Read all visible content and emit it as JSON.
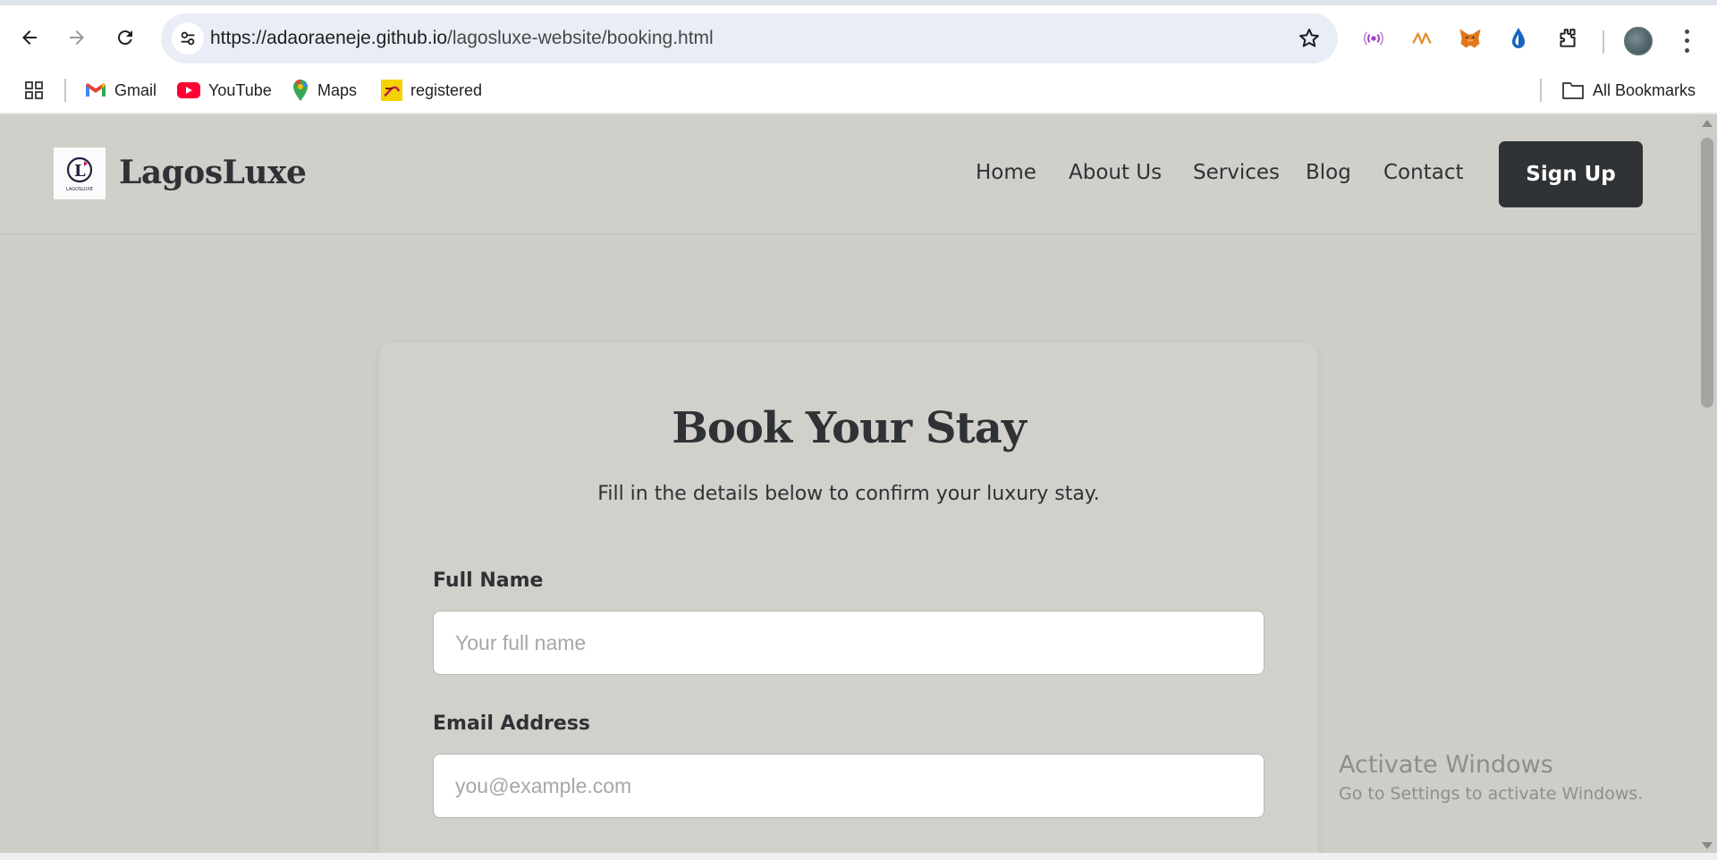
{
  "browser": {
    "url_host": "https://adaoraeneje.github.io",
    "url_path": "/lagosluxe-website/booking.html",
    "bookmarks": [
      {
        "label": "Gmail"
      },
      {
        "label": "YouTube"
      },
      {
        "label": "Maps"
      },
      {
        "label": "registered"
      }
    ],
    "all_bookmarks_label": "All Bookmarks"
  },
  "site": {
    "brand": "LagosLuxe",
    "logo_text": "LAGOSLUXE",
    "nav": [
      "Home",
      "About Us",
      "Services",
      "Blog",
      "Contact"
    ],
    "signup_label": "Sign Up"
  },
  "booking": {
    "title": "Book Your Stay",
    "subtitle": "Fill in the details below to confirm your luxury stay.",
    "fields": [
      {
        "label": "Full Name",
        "placeholder": "Your full name",
        "value": ""
      },
      {
        "label": "Email Address",
        "placeholder": "you@example.com",
        "value": ""
      }
    ]
  },
  "watermark": {
    "line1": "Activate Windows",
    "line2": "Go to Settings to activate Windows."
  },
  "colors": {
    "page_bg": "#cfcdc8",
    "dark": "#303335",
    "omnibox": "#e9eef6"
  }
}
